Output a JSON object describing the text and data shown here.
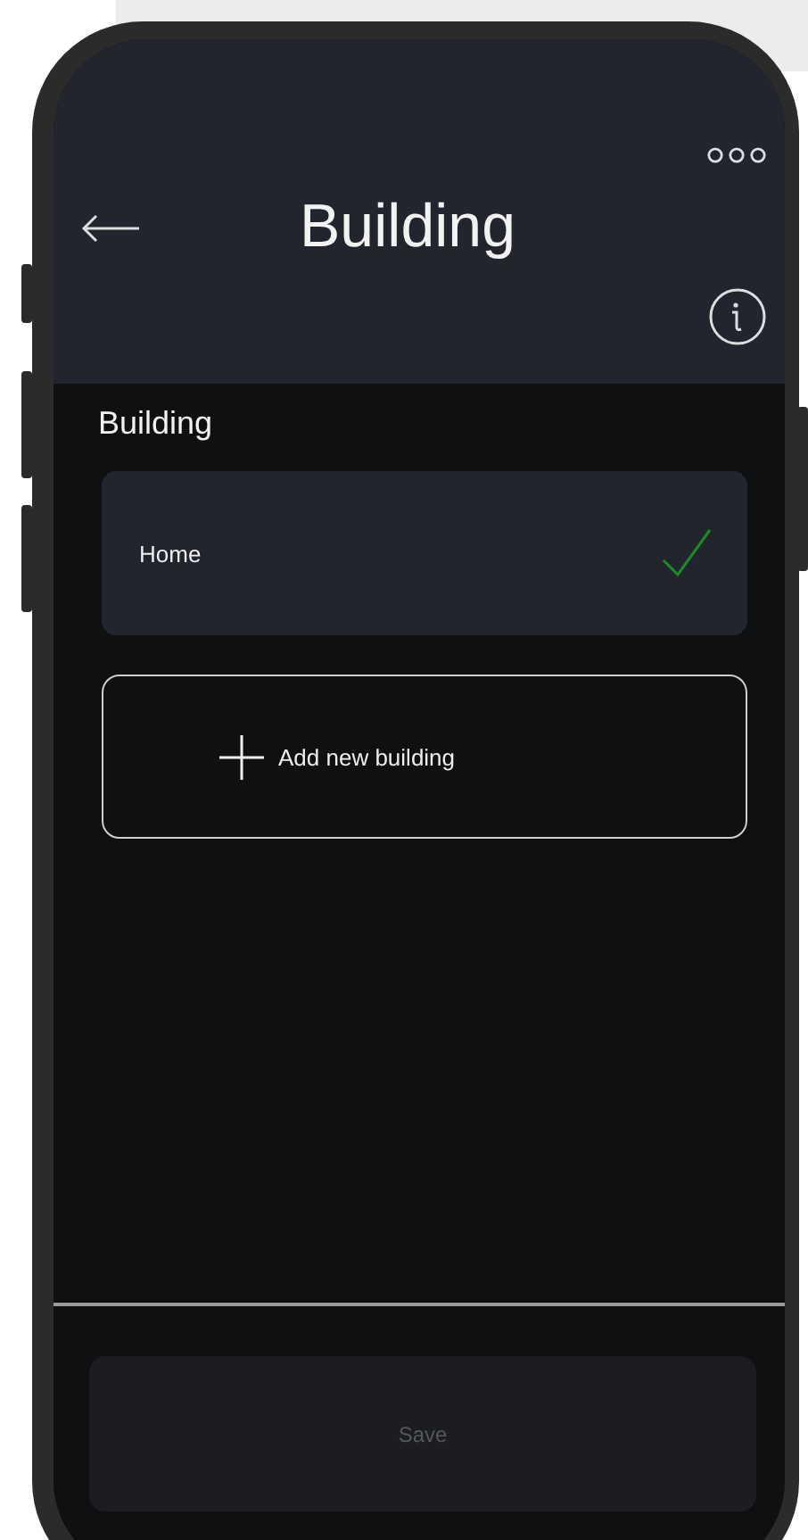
{
  "header": {
    "title": "Building"
  },
  "section_label": "Building",
  "buildings": [
    {
      "name": "Home",
      "selected": true
    }
  ],
  "add_button": {
    "label": "Add new building"
  },
  "save_button": {
    "label": "Save",
    "disabled": true
  }
}
